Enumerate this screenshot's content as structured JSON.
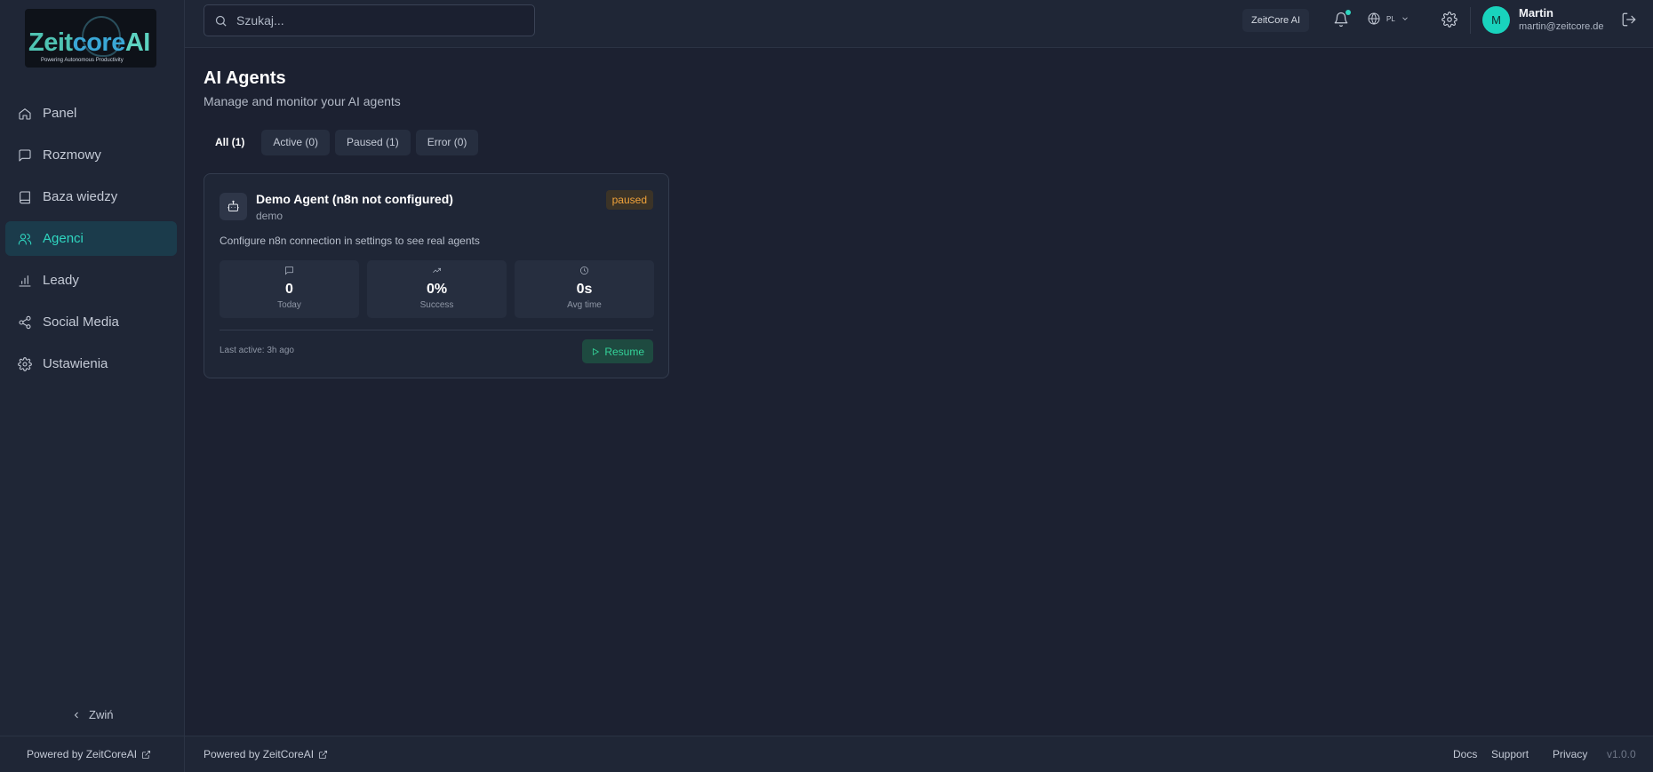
{
  "brand": {
    "logo_text_a": "Zeit",
    "logo_text_b": "core",
    "logo_text_c": "AI",
    "tagline": "Powering Autonomous Productivity"
  },
  "sidebar": {
    "items": [
      {
        "label": "Panel",
        "icon": "home-icon"
      },
      {
        "label": "Rozmowy",
        "icon": "chat-icon"
      },
      {
        "label": "Baza wiedzy",
        "icon": "book-icon"
      },
      {
        "label": "Agenci",
        "icon": "users-icon",
        "active": true
      },
      {
        "label": "Leady",
        "icon": "bar-chart-icon"
      },
      {
        "label": "Social Media",
        "icon": "share-icon"
      },
      {
        "label": "Ustawienia",
        "icon": "gear-icon"
      }
    ],
    "collapse_label": "Zwiń"
  },
  "header": {
    "search_placeholder": "Szukaj...",
    "org_badge": "ZeitCore AI",
    "language": "PL",
    "user": {
      "initial": "M",
      "name": "Martin",
      "email": "martin@zeitcore.de"
    }
  },
  "main": {
    "title": "AI Agents",
    "subtitle": "Manage and monitor your AI agents",
    "tabs": [
      {
        "label": "All (1)",
        "active": true
      },
      {
        "label": "Active (0)"
      },
      {
        "label": "Paused (1)"
      },
      {
        "label": "Error (0)"
      }
    ],
    "agent": {
      "name": "Demo Agent (n8n not configured)",
      "type": "demo",
      "status": "paused",
      "description": "Configure n8n connection in settings to see real agents",
      "stats": [
        {
          "value": "0",
          "label": "Today",
          "icon": "message-icon"
        },
        {
          "value": "0%",
          "label": "Success",
          "icon": "trending-up-icon"
        },
        {
          "value": "0s",
          "label": "Avg time",
          "icon": "clock-icon"
        }
      ],
      "last_active": "Last active: 3h ago",
      "resume_label": "Resume"
    }
  },
  "footer": {
    "sidebar_powered": "Powered by ZeitCoreAI",
    "powered": "Powered by ZeitCoreAI",
    "links": [
      "Docs",
      "Support",
      "Privacy"
    ],
    "version": "v1.0.0"
  },
  "colors": {
    "background": "#1c2131",
    "panel": "#1f2636",
    "accent": "#2fd6c0",
    "paused": "#f0a23a",
    "resume": "#34d399"
  }
}
